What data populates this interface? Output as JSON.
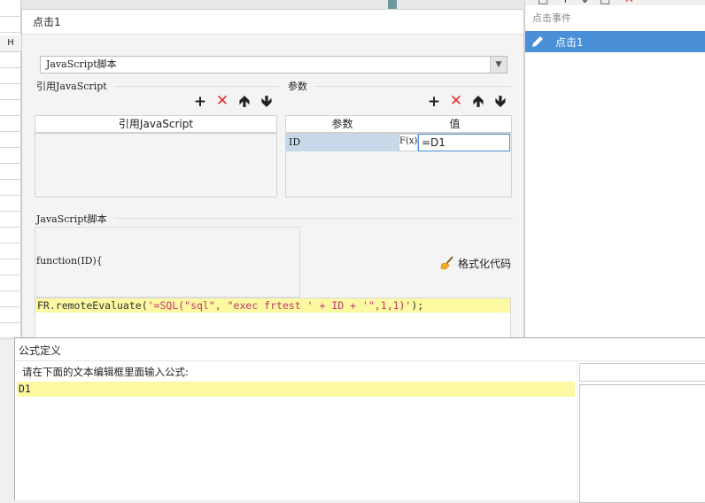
{
  "sheet": {
    "column_header": "H"
  },
  "dialog": {
    "title": "点击1",
    "script_type": "JavaScript脚本",
    "ref_js": {
      "section_label": "引用JavaScript",
      "column_header": "引用JavaScript"
    },
    "params": {
      "section_label": "参数",
      "headers": [
        "参数",
        "值"
      ],
      "rows": [
        {
          "name": "ID",
          "formula_button": "F(x)",
          "value": "=D1"
        }
      ]
    },
    "script": {
      "section_label": "JavaScript脚本",
      "function_signature": "function(ID){",
      "format_button": "格式化代码",
      "code_parts": {
        "p1": "FR.remoteEvaluate(",
        "p2": "'=SQL(\"sql\", \"exec frtest ' + ID + '\",1,1)'",
        "p3": ");"
      }
    }
  },
  "right_panel": {
    "header": "点击事件",
    "items": [
      {
        "label": "点击1",
        "selected": true
      }
    ],
    "accent": "#4a90d9"
  },
  "formula_dialog": {
    "title": "公式定义",
    "prompt": "请在下面的文本编辑框里面输入公式:",
    "formula": "D1"
  },
  "colors": {
    "highlight": "#fcf9a2",
    "delete_icon": "#e03030",
    "selected_cell": "#c7d9e8"
  }
}
